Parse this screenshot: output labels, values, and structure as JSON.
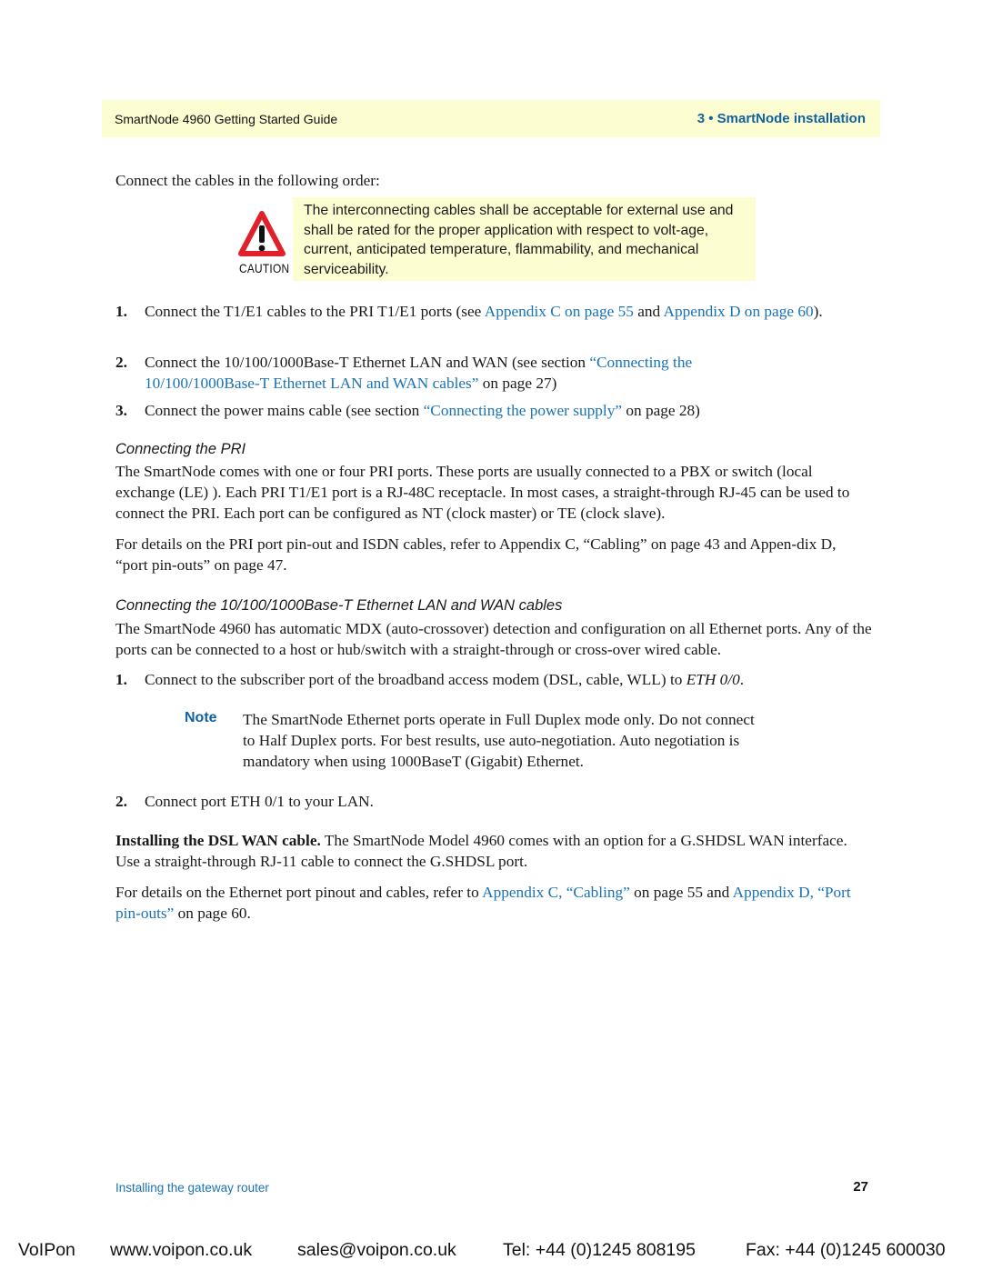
{
  "header": {
    "guide_title": "SmartNode 4960 Getting Started Guide",
    "chapter": "3 • SmartNode installation"
  },
  "intro": "Connect the cables in the following order:",
  "caution": {
    "icon": "warning-triangle-icon",
    "label": "CAUTION",
    "text": "The interconnecting cables shall be acceptable for external use and shall be rated for the proper application with respect to volt-age, current, anticipated temperature, flammability, and mechanical serviceability."
  },
  "steps1": [
    {
      "num": "1.",
      "pre": "Connect the T1/E1 cables to the PRI T1/E1 ports (see ",
      "link1": "Appendix C on page 55",
      "mid": " and ",
      "link2": "Appendix D on page 60",
      "post": ")."
    },
    {
      "num": "2.",
      "pre": "Connect the 10/100/1000Base-T Ethernet LAN and WAN (see section ",
      "link1": "“Connecting the 10/100/1000Base-T Ethernet LAN and WAN cables”",
      "post": " on page 27)"
    },
    {
      "num": "3.",
      "pre": "Connect the power mains cable (see section ",
      "link1": "“Connecting the power supply”",
      "post": " on page 28)"
    }
  ],
  "pri": {
    "heading": "Connecting the PRI",
    "para1": "The SmartNode comes with one or four PRI ports. These ports are usually connected to a PBX or switch (local exchange (LE) ). Each PRI T1/E1 port is a RJ-48C receptacle. In most cases, a straight-through RJ-45 can be used to connect the PRI. Each port can be configured as NT (clock master) or TE (clock slave).",
    "para2": "For details on the PRI port pin-out and ISDN cables, refer to Appendix C, “Cabling” on page 43 and Appen-dix D, “port pin-outs” on page 47."
  },
  "ethernet": {
    "heading": "Connecting the 10/100/1000Base-T Ethernet LAN and WAN cables",
    "para1": "The SmartNode 4960 has automatic MDX (auto-crossover) detection and configuration on all Ethernet ports. Any of the ports can be connected to a host or hub/switch with a straight-through or cross-over wired cable.",
    "step1_num": "1.",
    "step1_text": "Connect to the subscriber port of the broadband access modem (DSL, cable, WLL) to ",
    "step1_italic": "ETH 0/0",
    "step1_end": ".",
    "note_label": "Note",
    "note_text": "The SmartNode Ethernet ports operate in Full Duplex mode only. Do not connect to Half Duplex ports. For best results, use auto-negotiation. Auto negotiation is mandatory when using 1000BaseT (Gigabit) Ethernet.",
    "step2_num": "2.",
    "step2_text": "Connect port ETH 0/1 to your LAN."
  },
  "dsl": {
    "bold_lead": "Installing the DSL WAN cable.",
    "text": " The SmartNode Model 4960 comes with an option for a G.SHDSL WAN interface. Use a straight-through RJ-11 cable to connect the G.SHDSL port.",
    "details_pre": "For details on the Ethernet port pinout and cables, refer to ",
    "details_link1": "Appendix C, “Cabling”",
    "details_mid": " on page 55 and ",
    "details_link2": "Appendix D, “Port pin-outs”",
    "details_post": " on page 60."
  },
  "footer": {
    "section": "Installing the gateway router",
    "page_number": "27"
  },
  "bottom_bar": {
    "brand": "VoIPon",
    "website": "www.voipon.co.uk",
    "email": "sales@voipon.co.uk",
    "tel": "Tel: +44 (0)1245 808195",
    "fax": "Fax: +44 (0)1245 600030"
  },
  "colors": {
    "band": "#fdfdd2",
    "accent_blue": "#1163a2",
    "link_blue": "#1a73b5",
    "caution_red": "#e0212b"
  }
}
